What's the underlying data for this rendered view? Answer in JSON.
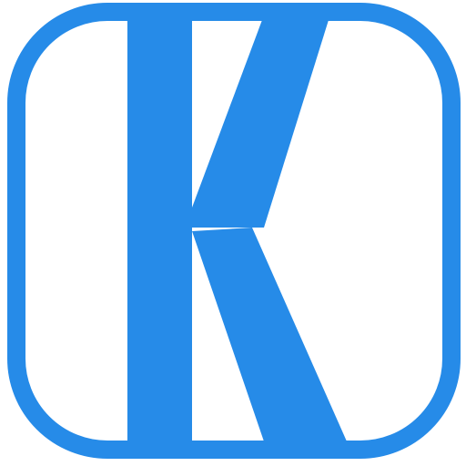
{
  "icon": {
    "glyph": "K",
    "name": "k-logo-icon"
  },
  "colors": {
    "brand": "#268BE8",
    "background": "#FFFFFF"
  }
}
